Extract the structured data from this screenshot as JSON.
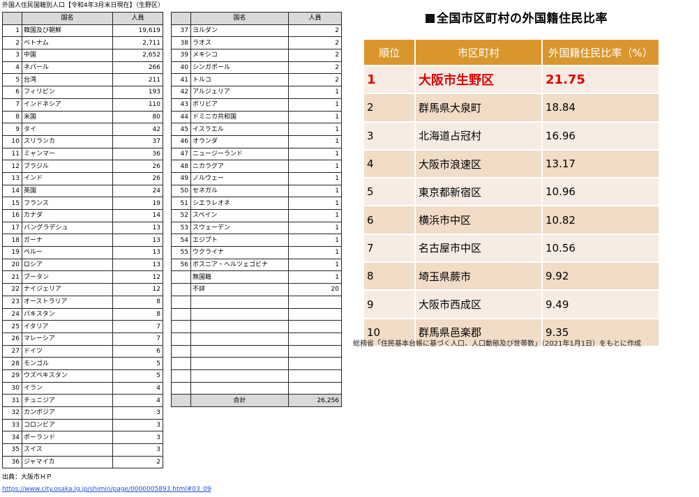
{
  "sheet": {
    "title": "外国人住民国籍別人口【令和4年3月末日現在】（生野区）",
    "headers": {
      "country": "国名",
      "population": "人員"
    },
    "left_rows": [
      {
        "no": "1",
        "country": "韓国及び朝鮮",
        "population": "19,619"
      },
      {
        "no": "2",
        "country": "ベトナム",
        "population": "2,711"
      },
      {
        "no": "3",
        "country": "中国",
        "population": "2,652"
      },
      {
        "no": "4",
        "country": "ネパール",
        "population": "266"
      },
      {
        "no": "5",
        "country": "台湾",
        "population": "211"
      },
      {
        "no": "6",
        "country": "フィリピン",
        "population": "193"
      },
      {
        "no": "7",
        "country": "インドネシア",
        "population": "110"
      },
      {
        "no": "8",
        "country": "米国",
        "population": "80"
      },
      {
        "no": "9",
        "country": "タイ",
        "population": "42"
      },
      {
        "no": "10",
        "country": "スリランカ",
        "population": "37"
      },
      {
        "no": "11",
        "country": "ミャンマー",
        "population": "36"
      },
      {
        "no": "12",
        "country": "ブラジル",
        "population": "26"
      },
      {
        "no": "13",
        "country": "インド",
        "population": "26"
      },
      {
        "no": "14",
        "country": "英国",
        "population": "24"
      },
      {
        "no": "15",
        "country": "フランス",
        "population": "19"
      },
      {
        "no": "16",
        "country": "カナダ",
        "population": "14"
      },
      {
        "no": "17",
        "country": "バングラデシュ",
        "population": "13"
      },
      {
        "no": "18",
        "country": "ガーナ",
        "population": "13"
      },
      {
        "no": "19",
        "country": "ペルー",
        "population": "13"
      },
      {
        "no": "20",
        "country": "ロシア",
        "population": "13"
      },
      {
        "no": "21",
        "country": "ブータン",
        "population": "12"
      },
      {
        "no": "22",
        "country": "ナイジェリア",
        "population": "12"
      },
      {
        "no": "23",
        "country": "オーストラリア",
        "population": "8"
      },
      {
        "no": "24",
        "country": "パキスタン",
        "population": "8"
      },
      {
        "no": "25",
        "country": "イタリア",
        "population": "7"
      },
      {
        "no": "26",
        "country": "マレーシア",
        "population": "7"
      },
      {
        "no": "27",
        "country": "ドイツ",
        "population": "6"
      },
      {
        "no": "28",
        "country": "モンゴル",
        "population": "5"
      },
      {
        "no": "29",
        "country": "ウズベキスタン",
        "population": "5"
      },
      {
        "no": "30",
        "country": "イラン",
        "population": "4"
      },
      {
        "no": "31",
        "country": "チュニジア",
        "population": "4"
      },
      {
        "no": "32",
        "country": "カンボジア",
        "population": "3"
      },
      {
        "no": "33",
        "country": "コロンビア",
        "population": "3"
      },
      {
        "no": "34",
        "country": "ポーランド",
        "population": "3"
      },
      {
        "no": "35",
        "country": "スイス",
        "population": "3"
      },
      {
        "no": "36",
        "country": "ジャマイカ",
        "population": "2"
      }
    ],
    "right_rows": [
      {
        "no": "37",
        "country": "ヨルダン",
        "population": "2"
      },
      {
        "no": "38",
        "country": "ラオス",
        "population": "2"
      },
      {
        "no": "39",
        "country": "メキシコ",
        "population": "2"
      },
      {
        "no": "40",
        "country": "シンガポール",
        "population": "2"
      },
      {
        "no": "41",
        "country": "トルコ",
        "population": "2"
      },
      {
        "no": "42",
        "country": "アルジェリア",
        "population": "1"
      },
      {
        "no": "43",
        "country": "ボリビア",
        "population": "1"
      },
      {
        "no": "44",
        "country": "ドミニカ共和国",
        "population": "1"
      },
      {
        "no": "45",
        "country": "イスラエル",
        "population": "1"
      },
      {
        "no": "46",
        "country": "オランダ",
        "population": "1"
      },
      {
        "no": "47",
        "country": "ニュージーランド",
        "population": "1"
      },
      {
        "no": "48",
        "country": "ニカラグア",
        "population": "1"
      },
      {
        "no": "49",
        "country": "ノルウェー",
        "population": "1"
      },
      {
        "no": "50",
        "country": "セネガル",
        "population": "1"
      },
      {
        "no": "51",
        "country": "シエラレオネ",
        "population": "1"
      },
      {
        "no": "52",
        "country": "スペイン",
        "population": "1"
      },
      {
        "no": "53",
        "country": "スウェーデン",
        "population": "1"
      },
      {
        "no": "54",
        "country": "エジプト",
        "population": "1"
      },
      {
        "no": "55",
        "country": "ウクライナ",
        "population": "1"
      },
      {
        "no": "56",
        "country": "ボスニア・ヘルツェゴビナ",
        "population": "1"
      },
      {
        "no": "",
        "country": "無国籍",
        "population": "1"
      },
      {
        "no": "",
        "country": "不詳",
        "population": "20"
      }
    ],
    "total": {
      "label": "合計",
      "value": "26,256"
    },
    "source_label": "出典：大阪市ＨＰ",
    "source_url": "https://www.city.osaka.lg.jp/shimin/page/0000005893.html#03_09"
  },
  "ranking": {
    "title": "全国市区町村の外国籍住民比率",
    "headers": {
      "rank": "順位",
      "city": "市区町村",
      "ratio": "外国籍住民比率（%）"
    },
    "rows": [
      {
        "rank": "1",
        "city": "大阪市生野区",
        "ratio": "21.75"
      },
      {
        "rank": "2",
        "city": "群馬県大泉町",
        "ratio": "18.84"
      },
      {
        "rank": "3",
        "city": "北海道占冠村",
        "ratio": "16.96"
      },
      {
        "rank": "4",
        "city": "大阪市浪速区",
        "ratio": "13.17"
      },
      {
        "rank": "5",
        "city": "東京都新宿区",
        "ratio": "10.96"
      },
      {
        "rank": "6",
        "city": "横浜市中区",
        "ratio": "10.82"
      },
      {
        "rank": "7",
        "city": "名古屋市中区",
        "ratio": "10.56"
      },
      {
        "rank": "8",
        "city": "埼玉県蕨市",
        "ratio": "9.92"
      },
      {
        "rank": "9",
        "city": "大阪市西成区",
        "ratio": "9.49"
      },
      {
        "rank": "10",
        "city": "群馬県邑楽郡",
        "ratio": "9.35"
      }
    ],
    "note": "総務省「住民基本台帳に基づく人口、人口動態及び世帯数」（2021年1月1日）をもとに作成"
  }
}
